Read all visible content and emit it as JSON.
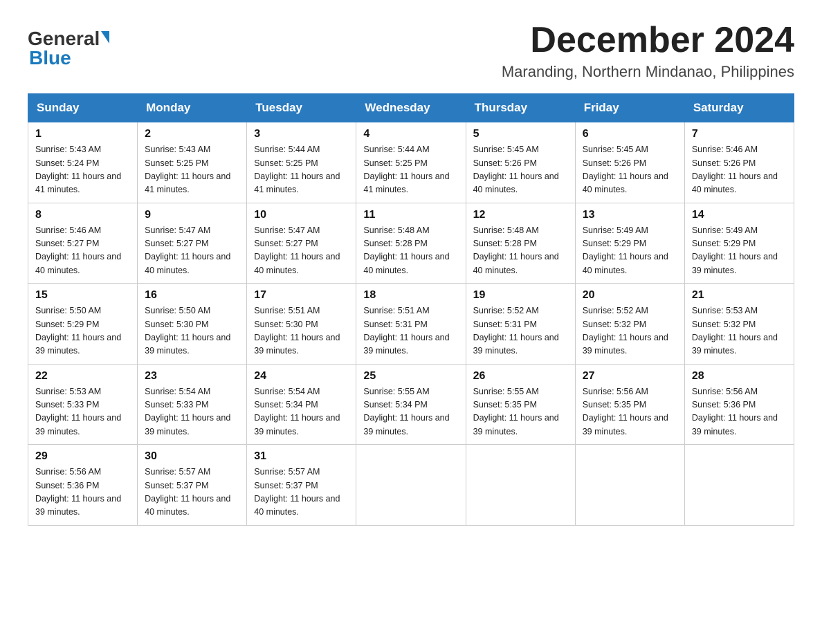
{
  "header": {
    "logo_general": "General",
    "logo_blue": "Blue",
    "month_year": "December 2024",
    "location": "Maranding, Northern Mindanao, Philippines"
  },
  "weekdays": [
    "Sunday",
    "Monday",
    "Tuesday",
    "Wednesday",
    "Thursday",
    "Friday",
    "Saturday"
  ],
  "weeks": [
    [
      {
        "day": "1",
        "sunrise": "5:43 AM",
        "sunset": "5:24 PM",
        "daylight": "11 hours and 41 minutes."
      },
      {
        "day": "2",
        "sunrise": "5:43 AM",
        "sunset": "5:25 PM",
        "daylight": "11 hours and 41 minutes."
      },
      {
        "day": "3",
        "sunrise": "5:44 AM",
        "sunset": "5:25 PM",
        "daylight": "11 hours and 41 minutes."
      },
      {
        "day": "4",
        "sunrise": "5:44 AM",
        "sunset": "5:25 PM",
        "daylight": "11 hours and 41 minutes."
      },
      {
        "day": "5",
        "sunrise": "5:45 AM",
        "sunset": "5:26 PM",
        "daylight": "11 hours and 40 minutes."
      },
      {
        "day": "6",
        "sunrise": "5:45 AM",
        "sunset": "5:26 PM",
        "daylight": "11 hours and 40 minutes."
      },
      {
        "day": "7",
        "sunrise": "5:46 AM",
        "sunset": "5:26 PM",
        "daylight": "11 hours and 40 minutes."
      }
    ],
    [
      {
        "day": "8",
        "sunrise": "5:46 AM",
        "sunset": "5:27 PM",
        "daylight": "11 hours and 40 minutes."
      },
      {
        "day": "9",
        "sunrise": "5:47 AM",
        "sunset": "5:27 PM",
        "daylight": "11 hours and 40 minutes."
      },
      {
        "day": "10",
        "sunrise": "5:47 AM",
        "sunset": "5:27 PM",
        "daylight": "11 hours and 40 minutes."
      },
      {
        "day": "11",
        "sunrise": "5:48 AM",
        "sunset": "5:28 PM",
        "daylight": "11 hours and 40 minutes."
      },
      {
        "day": "12",
        "sunrise": "5:48 AM",
        "sunset": "5:28 PM",
        "daylight": "11 hours and 40 minutes."
      },
      {
        "day": "13",
        "sunrise": "5:49 AM",
        "sunset": "5:29 PM",
        "daylight": "11 hours and 40 minutes."
      },
      {
        "day": "14",
        "sunrise": "5:49 AM",
        "sunset": "5:29 PM",
        "daylight": "11 hours and 39 minutes."
      }
    ],
    [
      {
        "day": "15",
        "sunrise": "5:50 AM",
        "sunset": "5:29 PM",
        "daylight": "11 hours and 39 minutes."
      },
      {
        "day": "16",
        "sunrise": "5:50 AM",
        "sunset": "5:30 PM",
        "daylight": "11 hours and 39 minutes."
      },
      {
        "day": "17",
        "sunrise": "5:51 AM",
        "sunset": "5:30 PM",
        "daylight": "11 hours and 39 minutes."
      },
      {
        "day": "18",
        "sunrise": "5:51 AM",
        "sunset": "5:31 PM",
        "daylight": "11 hours and 39 minutes."
      },
      {
        "day": "19",
        "sunrise": "5:52 AM",
        "sunset": "5:31 PM",
        "daylight": "11 hours and 39 minutes."
      },
      {
        "day": "20",
        "sunrise": "5:52 AM",
        "sunset": "5:32 PM",
        "daylight": "11 hours and 39 minutes."
      },
      {
        "day": "21",
        "sunrise": "5:53 AM",
        "sunset": "5:32 PM",
        "daylight": "11 hours and 39 minutes."
      }
    ],
    [
      {
        "day": "22",
        "sunrise": "5:53 AM",
        "sunset": "5:33 PM",
        "daylight": "11 hours and 39 minutes."
      },
      {
        "day": "23",
        "sunrise": "5:54 AM",
        "sunset": "5:33 PM",
        "daylight": "11 hours and 39 minutes."
      },
      {
        "day": "24",
        "sunrise": "5:54 AM",
        "sunset": "5:34 PM",
        "daylight": "11 hours and 39 minutes."
      },
      {
        "day": "25",
        "sunrise": "5:55 AM",
        "sunset": "5:34 PM",
        "daylight": "11 hours and 39 minutes."
      },
      {
        "day": "26",
        "sunrise": "5:55 AM",
        "sunset": "5:35 PM",
        "daylight": "11 hours and 39 minutes."
      },
      {
        "day": "27",
        "sunrise": "5:56 AM",
        "sunset": "5:35 PM",
        "daylight": "11 hours and 39 minutes."
      },
      {
        "day": "28",
        "sunrise": "5:56 AM",
        "sunset": "5:36 PM",
        "daylight": "11 hours and 39 minutes."
      }
    ],
    [
      {
        "day": "29",
        "sunrise": "5:56 AM",
        "sunset": "5:36 PM",
        "daylight": "11 hours and 39 minutes."
      },
      {
        "day": "30",
        "sunrise": "5:57 AM",
        "sunset": "5:37 PM",
        "daylight": "11 hours and 40 minutes."
      },
      {
        "day": "31",
        "sunrise": "5:57 AM",
        "sunset": "5:37 PM",
        "daylight": "11 hours and 40 minutes."
      },
      null,
      null,
      null,
      null
    ]
  ]
}
